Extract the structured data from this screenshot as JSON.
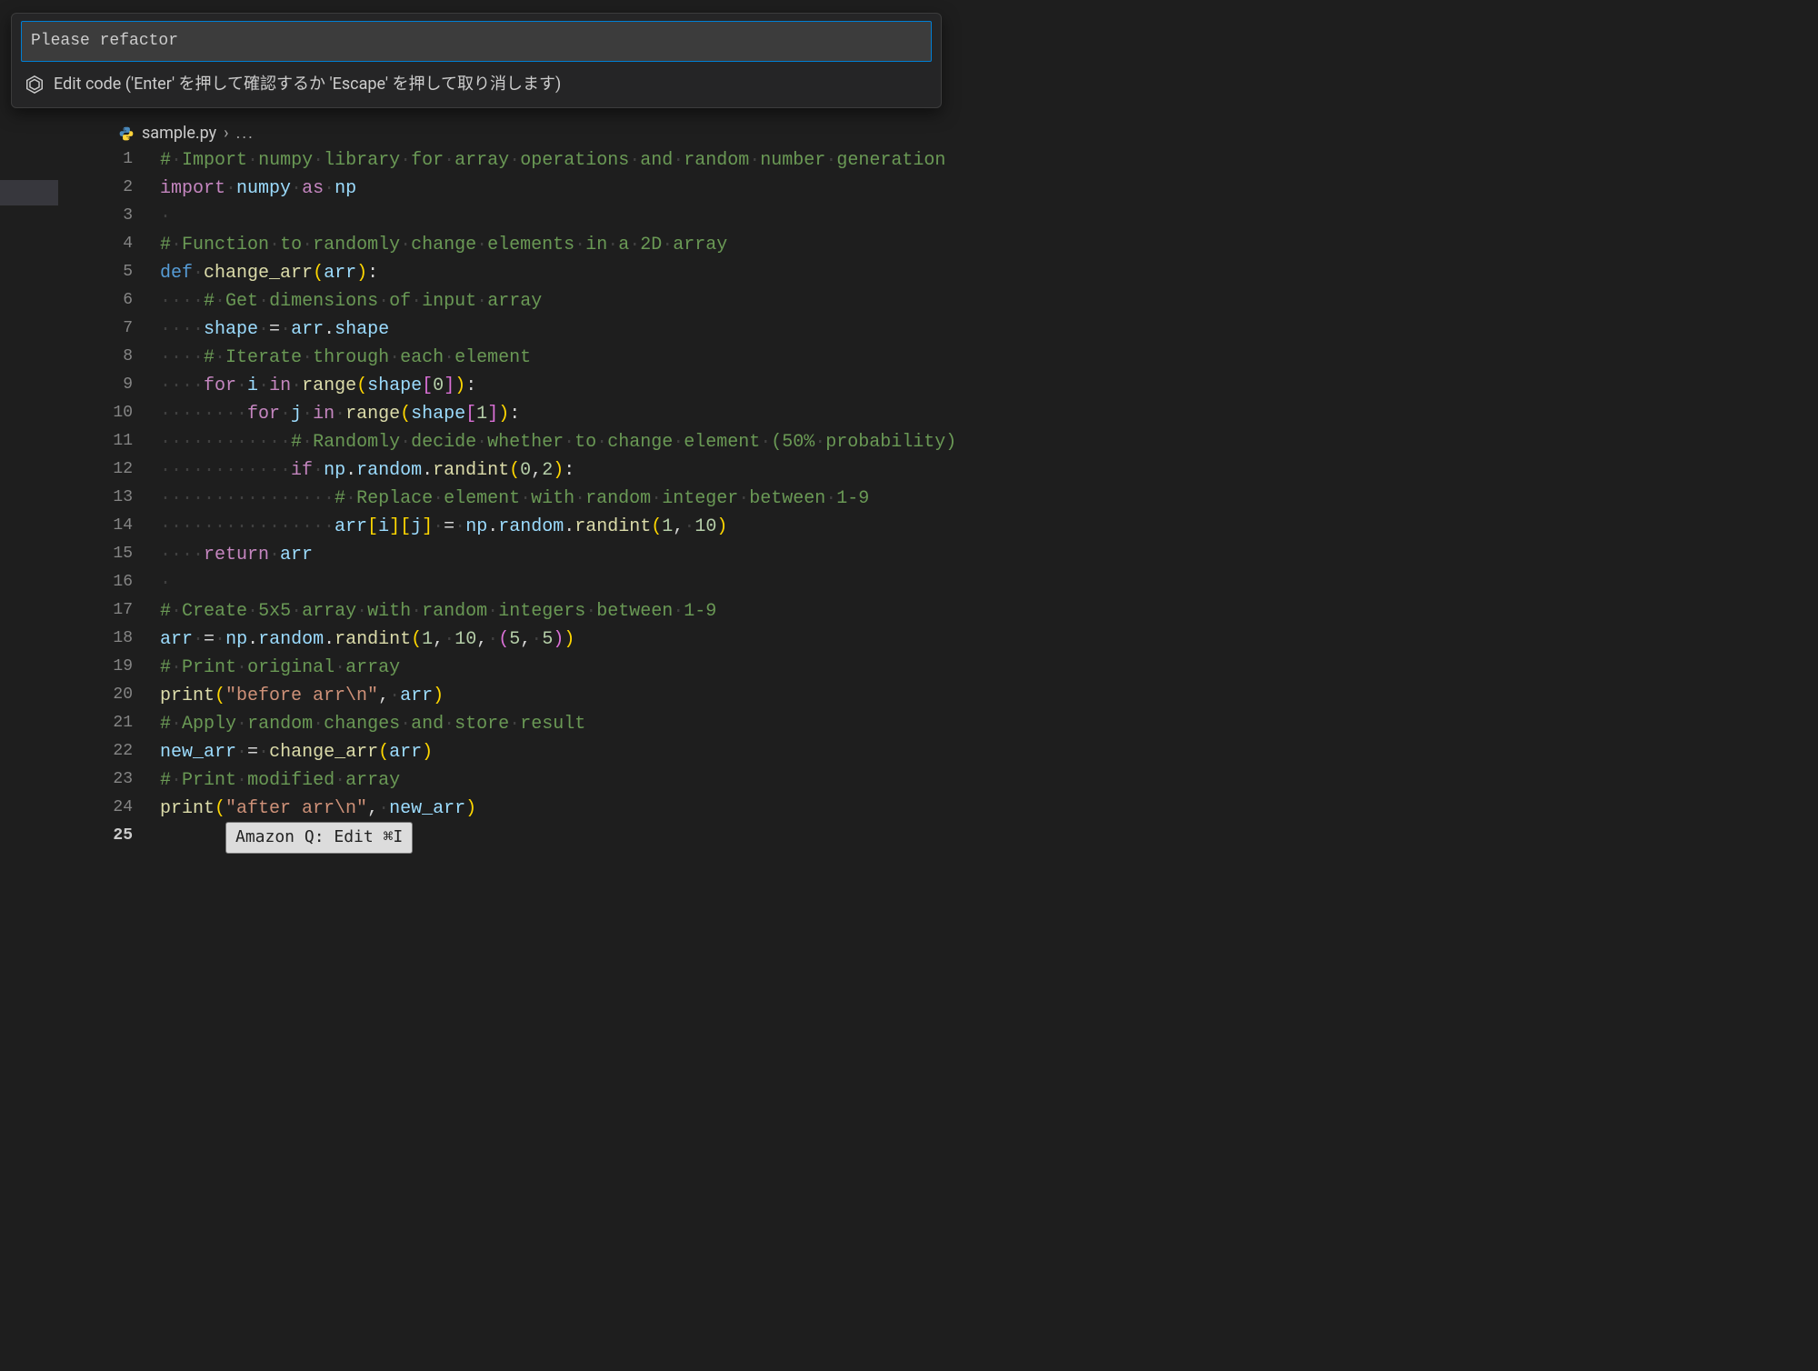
{
  "dialog": {
    "input_value": "Please refactor",
    "help_text": "Edit code ('Enter' を押して確認するか 'Escape' を押して取り消します)"
  },
  "breadcrumb": {
    "file": "sample.py",
    "rest": "..."
  },
  "codelens": {
    "label": "Amazon Q: Edit ⌘I"
  },
  "editor": {
    "selected_lines_from": 1,
    "selected_lines_to": 24,
    "whitespace_indicator": "·",
    "lines": [
      {
        "n": 1,
        "sel": true,
        "tokens": [
          {
            "t": "# Import numpy library for array operations and random number generation",
            "c": "comment",
            "ws": true
          }
        ]
      },
      {
        "n": 2,
        "sel": true,
        "tokens": [
          {
            "t": "import",
            "c": "kw"
          },
          {
            "t": " ",
            "c": "ws"
          },
          {
            "t": "numpy",
            "c": "ident"
          },
          {
            "t": " ",
            "c": "ws"
          },
          {
            "t": "as",
            "c": "kw"
          },
          {
            "t": " ",
            "c": "ws"
          },
          {
            "t": "np",
            "c": "ident"
          }
        ]
      },
      {
        "n": 3,
        "sel": true,
        "tokens": [
          {
            "t": " ",
            "c": "ws"
          }
        ]
      },
      {
        "n": 4,
        "sel": true,
        "tokens": [
          {
            "t": "# Function to randomly change elements in a 2D array",
            "c": "comment",
            "ws": true
          }
        ]
      },
      {
        "n": 5,
        "sel": true,
        "tokens": [
          {
            "t": "def",
            "c": "def"
          },
          {
            "t": " ",
            "c": "ws"
          },
          {
            "t": "change_arr",
            "c": "func"
          },
          {
            "t": "(",
            "c": "paren"
          },
          {
            "t": "arr",
            "c": "ident"
          },
          {
            "t": ")",
            "c": "paren"
          },
          {
            "t": ":",
            "c": "op"
          }
        ]
      },
      {
        "n": 6,
        "sel": true,
        "tokens": [
          {
            "t": "    ",
            "c": "ws"
          },
          {
            "t": "# Get dimensions of input array",
            "c": "comment",
            "ws": true
          }
        ]
      },
      {
        "n": 7,
        "sel": true,
        "tokens": [
          {
            "t": "    ",
            "c": "ws"
          },
          {
            "t": "shape",
            "c": "ident"
          },
          {
            "t": " ",
            "c": "ws"
          },
          {
            "t": "=",
            "c": "op"
          },
          {
            "t": " ",
            "c": "ws"
          },
          {
            "t": "arr",
            "c": "ident"
          },
          {
            "t": ".",
            "c": "op"
          },
          {
            "t": "shape",
            "c": "ident"
          }
        ]
      },
      {
        "n": 8,
        "sel": true,
        "tokens": [
          {
            "t": "    ",
            "c": "ws"
          },
          {
            "t": "# Iterate through each element",
            "c": "comment",
            "ws": true
          }
        ]
      },
      {
        "n": 9,
        "sel": true,
        "tokens": [
          {
            "t": "    ",
            "c": "ws"
          },
          {
            "t": "for",
            "c": "kw"
          },
          {
            "t": " ",
            "c": "ws"
          },
          {
            "t": "i",
            "c": "ident"
          },
          {
            "t": " ",
            "c": "ws"
          },
          {
            "t": "in",
            "c": "kw"
          },
          {
            "t": " ",
            "c": "ws"
          },
          {
            "t": "range",
            "c": "func"
          },
          {
            "t": "(",
            "c": "paren"
          },
          {
            "t": "shape",
            "c": "ident"
          },
          {
            "t": "[",
            "c": "paren2"
          },
          {
            "t": "0",
            "c": "num"
          },
          {
            "t": "]",
            "c": "paren2"
          },
          {
            "t": ")",
            "c": "paren"
          },
          {
            "t": ":",
            "c": "op"
          }
        ]
      },
      {
        "n": 10,
        "sel": true,
        "tokens": [
          {
            "t": "        ",
            "c": "ws"
          },
          {
            "t": "for",
            "c": "kw"
          },
          {
            "t": " ",
            "c": "ws"
          },
          {
            "t": "j",
            "c": "ident"
          },
          {
            "t": " ",
            "c": "ws"
          },
          {
            "t": "in",
            "c": "kw"
          },
          {
            "t": " ",
            "c": "ws"
          },
          {
            "t": "range",
            "c": "func"
          },
          {
            "t": "(",
            "c": "paren"
          },
          {
            "t": "shape",
            "c": "ident"
          },
          {
            "t": "[",
            "c": "paren2"
          },
          {
            "t": "1",
            "c": "num"
          },
          {
            "t": "]",
            "c": "paren2"
          },
          {
            "t": ")",
            "c": "paren"
          },
          {
            "t": ":",
            "c": "op"
          }
        ]
      },
      {
        "n": 11,
        "sel": true,
        "tokens": [
          {
            "t": "            ",
            "c": "ws"
          },
          {
            "t": "# Randomly decide whether to change element (50% probability)",
            "c": "comment",
            "ws": true
          }
        ]
      },
      {
        "n": 12,
        "sel": true,
        "tokens": [
          {
            "t": "            ",
            "c": "ws"
          },
          {
            "t": "if",
            "c": "kw"
          },
          {
            "t": " ",
            "c": "ws"
          },
          {
            "t": "np",
            "c": "ident"
          },
          {
            "t": ".",
            "c": "op"
          },
          {
            "t": "random",
            "c": "ident"
          },
          {
            "t": ".",
            "c": "op"
          },
          {
            "t": "randint",
            "c": "func"
          },
          {
            "t": "(",
            "c": "paren"
          },
          {
            "t": "0",
            "c": "num"
          },
          {
            "t": ",",
            "c": "op"
          },
          {
            "t": "2",
            "c": "num"
          },
          {
            "t": ")",
            "c": "paren"
          },
          {
            "t": ":",
            "c": "op"
          }
        ]
      },
      {
        "n": 13,
        "sel": true,
        "tokens": [
          {
            "t": "                ",
            "c": "ws"
          },
          {
            "t": "# Replace element with random integer between 1-9",
            "c": "comment",
            "ws": true
          }
        ]
      },
      {
        "n": 14,
        "sel": true,
        "tokens": [
          {
            "t": "                ",
            "c": "ws"
          },
          {
            "t": "arr",
            "c": "ident"
          },
          {
            "t": "[",
            "c": "paren"
          },
          {
            "t": "i",
            "c": "ident"
          },
          {
            "t": "]",
            "c": "paren"
          },
          {
            "t": "[",
            "c": "paren"
          },
          {
            "t": "j",
            "c": "ident"
          },
          {
            "t": "]",
            "c": "paren"
          },
          {
            "t": " ",
            "c": "ws"
          },
          {
            "t": "=",
            "c": "op"
          },
          {
            "t": " ",
            "c": "ws"
          },
          {
            "t": "np",
            "c": "ident"
          },
          {
            "t": ".",
            "c": "op"
          },
          {
            "t": "random",
            "c": "ident"
          },
          {
            "t": ".",
            "c": "op"
          },
          {
            "t": "randint",
            "c": "func"
          },
          {
            "t": "(",
            "c": "paren"
          },
          {
            "t": "1",
            "c": "num"
          },
          {
            "t": ",",
            "c": "op"
          },
          {
            "t": " ",
            "c": "ws"
          },
          {
            "t": "10",
            "c": "num"
          },
          {
            "t": ")",
            "c": "paren"
          }
        ]
      },
      {
        "n": 15,
        "sel": true,
        "tokens": [
          {
            "t": "    ",
            "c": "ws"
          },
          {
            "t": "return",
            "c": "kw"
          },
          {
            "t": " ",
            "c": "ws"
          },
          {
            "t": "arr",
            "c": "ident"
          }
        ]
      },
      {
        "n": 16,
        "sel": true,
        "tokens": [
          {
            "t": " ",
            "c": "ws"
          }
        ]
      },
      {
        "n": 17,
        "sel": true,
        "tokens": [
          {
            "t": "# Create 5x5 array with random integers between 1-9",
            "c": "comment",
            "ws": true
          }
        ]
      },
      {
        "n": 18,
        "sel": true,
        "tokens": [
          {
            "t": "arr",
            "c": "ident"
          },
          {
            "t": " ",
            "c": "ws"
          },
          {
            "t": "=",
            "c": "op"
          },
          {
            "t": " ",
            "c": "ws"
          },
          {
            "t": "np",
            "c": "ident"
          },
          {
            "t": ".",
            "c": "op"
          },
          {
            "t": "random",
            "c": "ident"
          },
          {
            "t": ".",
            "c": "op"
          },
          {
            "t": "randint",
            "c": "func"
          },
          {
            "t": "(",
            "c": "paren"
          },
          {
            "t": "1",
            "c": "num"
          },
          {
            "t": ",",
            "c": "op"
          },
          {
            "t": " ",
            "c": "ws"
          },
          {
            "t": "10",
            "c": "num"
          },
          {
            "t": ",",
            "c": "op"
          },
          {
            "t": " ",
            "c": "ws"
          },
          {
            "t": "(",
            "c": "paren2"
          },
          {
            "t": "5",
            "c": "num"
          },
          {
            "t": ",",
            "c": "op"
          },
          {
            "t": " ",
            "c": "ws"
          },
          {
            "t": "5",
            "c": "num"
          },
          {
            "t": ")",
            "c": "paren2"
          },
          {
            "t": ")",
            "c": "paren"
          }
        ]
      },
      {
        "n": 19,
        "sel": true,
        "tokens": [
          {
            "t": "# Print original array",
            "c": "comment",
            "ws": true
          }
        ]
      },
      {
        "n": 20,
        "sel": true,
        "tokens": [
          {
            "t": "print",
            "c": "func"
          },
          {
            "t": "(",
            "c": "paren"
          },
          {
            "t": "\"before arr\\n\"",
            "c": "str"
          },
          {
            "t": ",",
            "c": "op"
          },
          {
            "t": " ",
            "c": "ws"
          },
          {
            "t": "arr",
            "c": "ident"
          },
          {
            "t": ")",
            "c": "paren"
          }
        ]
      },
      {
        "n": 21,
        "sel": true,
        "tokens": [
          {
            "t": "# Apply random changes and store result",
            "c": "comment",
            "ws": true
          }
        ]
      },
      {
        "n": 22,
        "sel": true,
        "tokens": [
          {
            "t": "new_arr",
            "c": "ident"
          },
          {
            "t": " ",
            "c": "ws"
          },
          {
            "t": "=",
            "c": "op"
          },
          {
            "t": " ",
            "c": "ws"
          },
          {
            "t": "change_arr",
            "c": "func"
          },
          {
            "t": "(",
            "c": "paren"
          },
          {
            "t": "arr",
            "c": "ident"
          },
          {
            "t": ")",
            "c": "paren"
          }
        ]
      },
      {
        "n": 23,
        "sel": true,
        "tokens": [
          {
            "t": "# Print modified array",
            "c": "comment",
            "ws": true
          }
        ]
      },
      {
        "n": 24,
        "sel": true,
        "tokens": [
          {
            "t": "print",
            "c": "func"
          },
          {
            "t": "(",
            "c": "paren"
          },
          {
            "t": "\"after arr\\n\"",
            "c": "str"
          },
          {
            "t": ",",
            "c": "op"
          },
          {
            "t": " ",
            "c": "ws"
          },
          {
            "t": "new_arr",
            "c": "ident"
          },
          {
            "t": ")",
            "c": "paren"
          }
        ]
      },
      {
        "n": 25,
        "sel": false,
        "tokens": []
      }
    ]
  }
}
